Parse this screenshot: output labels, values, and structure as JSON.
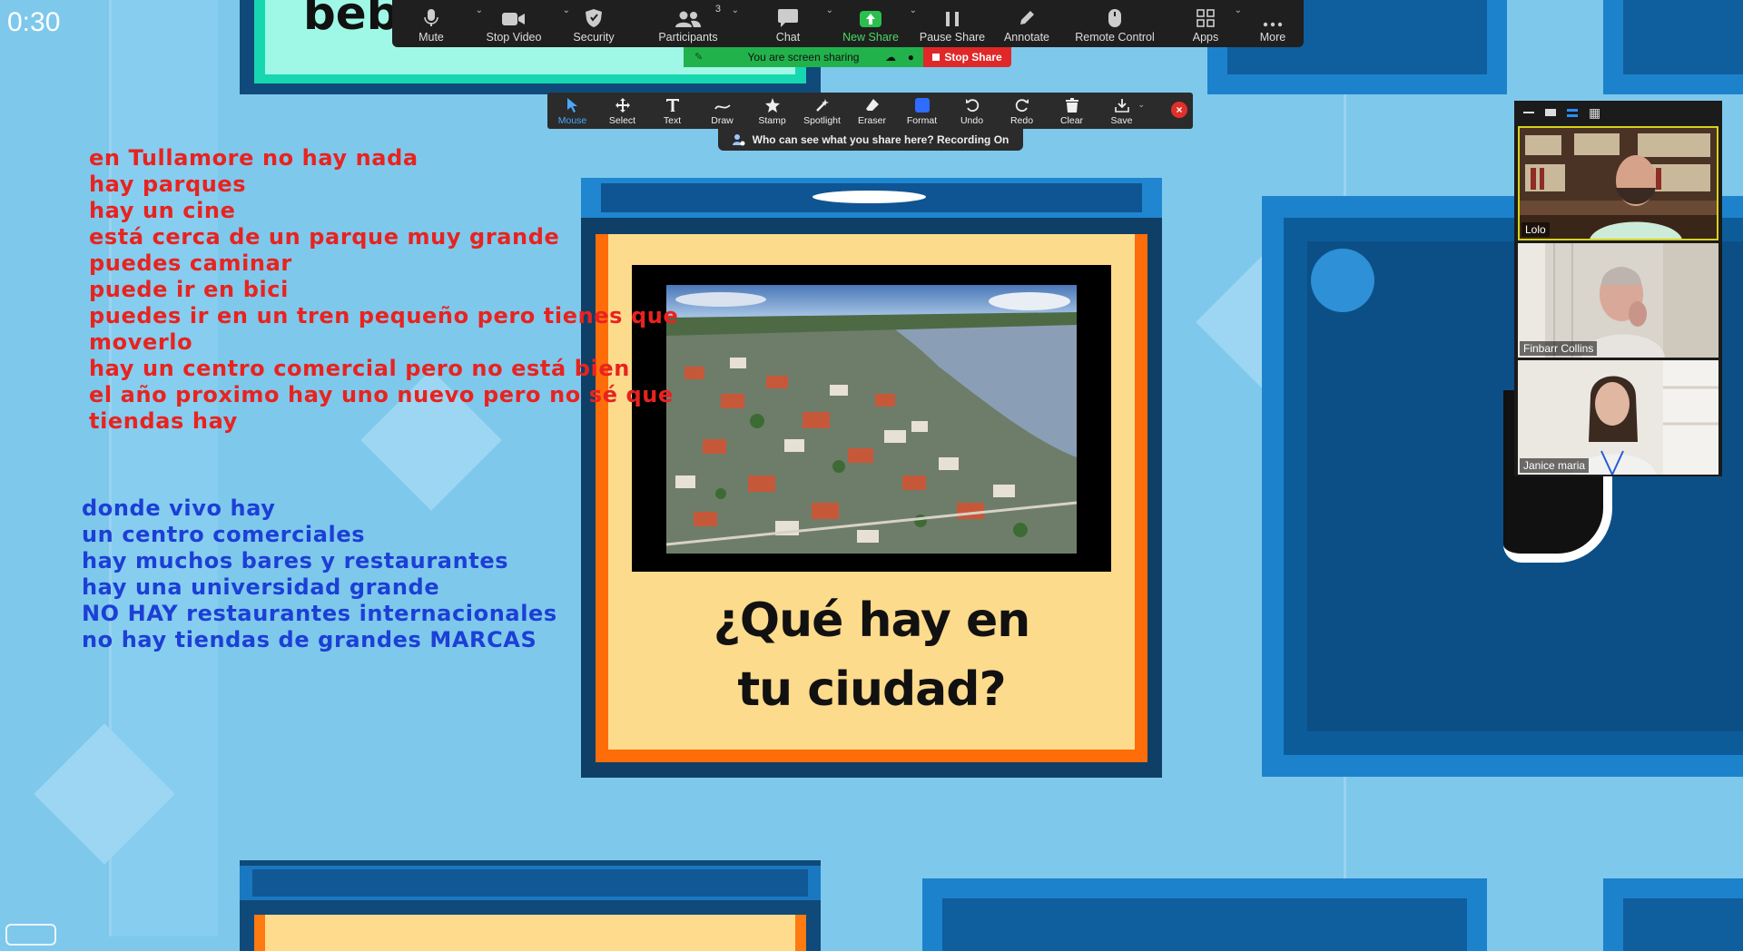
{
  "timer": "0:30",
  "slide_top_word": "beb",
  "meeting_toolbar": {
    "items": [
      {
        "label": "Mute",
        "icon": "microphone-icon",
        "caret": true
      },
      {
        "label": "Stop Video",
        "icon": "video-camera-icon",
        "caret": true
      },
      {
        "label": "Security",
        "icon": "shield-icon",
        "caret": false
      },
      {
        "label": "Participants",
        "icon": "participants-icon",
        "caret": true,
        "count": "3"
      },
      {
        "label": "Chat",
        "icon": "chat-icon",
        "caret": true
      },
      {
        "label": "New Share",
        "icon": "share-arrow-icon",
        "caret": true
      },
      {
        "label": "Pause Share",
        "icon": "pause-icon",
        "caret": false
      },
      {
        "label": "Annotate",
        "icon": "pencil-icon",
        "caret": false
      },
      {
        "label": "Remote Control",
        "icon": "mouse-icon",
        "caret": false
      },
      {
        "label": "Apps",
        "icon": "apps-icon",
        "caret": true
      },
      {
        "label": "More",
        "icon": "more-dots-icon",
        "caret": false
      }
    ],
    "share_status": "You are screen sharing",
    "stop_share": "Stop Share"
  },
  "annotation_toolbar": {
    "items": [
      {
        "label": "Mouse",
        "icon": "cursor-icon",
        "active": true
      },
      {
        "label": "Select",
        "icon": "move-icon",
        "active": false
      },
      {
        "label": "Text",
        "icon": "text-icon",
        "active": false
      },
      {
        "label": "Draw",
        "icon": "draw-icon",
        "active": false
      },
      {
        "label": "Stamp",
        "icon": "star-stamp-icon",
        "active": false
      },
      {
        "label": "Spotlight",
        "icon": "spotlight-icon",
        "active": false
      },
      {
        "label": "Eraser",
        "icon": "eraser-icon",
        "active": false
      },
      {
        "label": "Format",
        "icon": "format-icon",
        "active": false
      },
      {
        "label": "Undo",
        "icon": "undo-icon",
        "active": false
      },
      {
        "label": "Redo",
        "icon": "redo-icon",
        "active": false
      },
      {
        "label": "Clear",
        "icon": "trash-icon",
        "active": false
      },
      {
        "label": "Save",
        "icon": "save-icon",
        "active": false
      }
    ],
    "who_can_see": "Who can see what you share here? Recording On"
  },
  "slide": {
    "title_line1": "¿Qué hay en",
    "title_line2": "tu ciudad?"
  },
  "notes_red": [
    "en Tullamore no hay nada",
    "hay parques",
    "hay un cine",
    "está cerca de un parque muy grande",
    "puedes caminar",
    "puede ir en bici",
    "puedes ir en un tren pequeño pero tienes que",
    "moverlo",
    "hay un centro comercial pero no está bien",
    "el año proximo hay uno nuevo pero no sé que",
    "tiendas hay"
  ],
  "notes_blue": [
    "donde vivo hay",
    "un centro comerciales",
    "hay muchos bares y restaurantes",
    "hay una universidad grande",
    "NO HAY restaurantes internacionales",
    "no hay tiendas de grandes MARCAS"
  ],
  "participants": [
    {
      "name": "Lolo"
    },
    {
      "name": "Finbarr Collins"
    },
    {
      "name": "Janice maria"
    }
  ],
  "colors": {
    "notes_red": "#e8231f",
    "notes_blue": "#1c3fd6",
    "share_green": "#22b24c",
    "stop_red": "#e02828"
  }
}
